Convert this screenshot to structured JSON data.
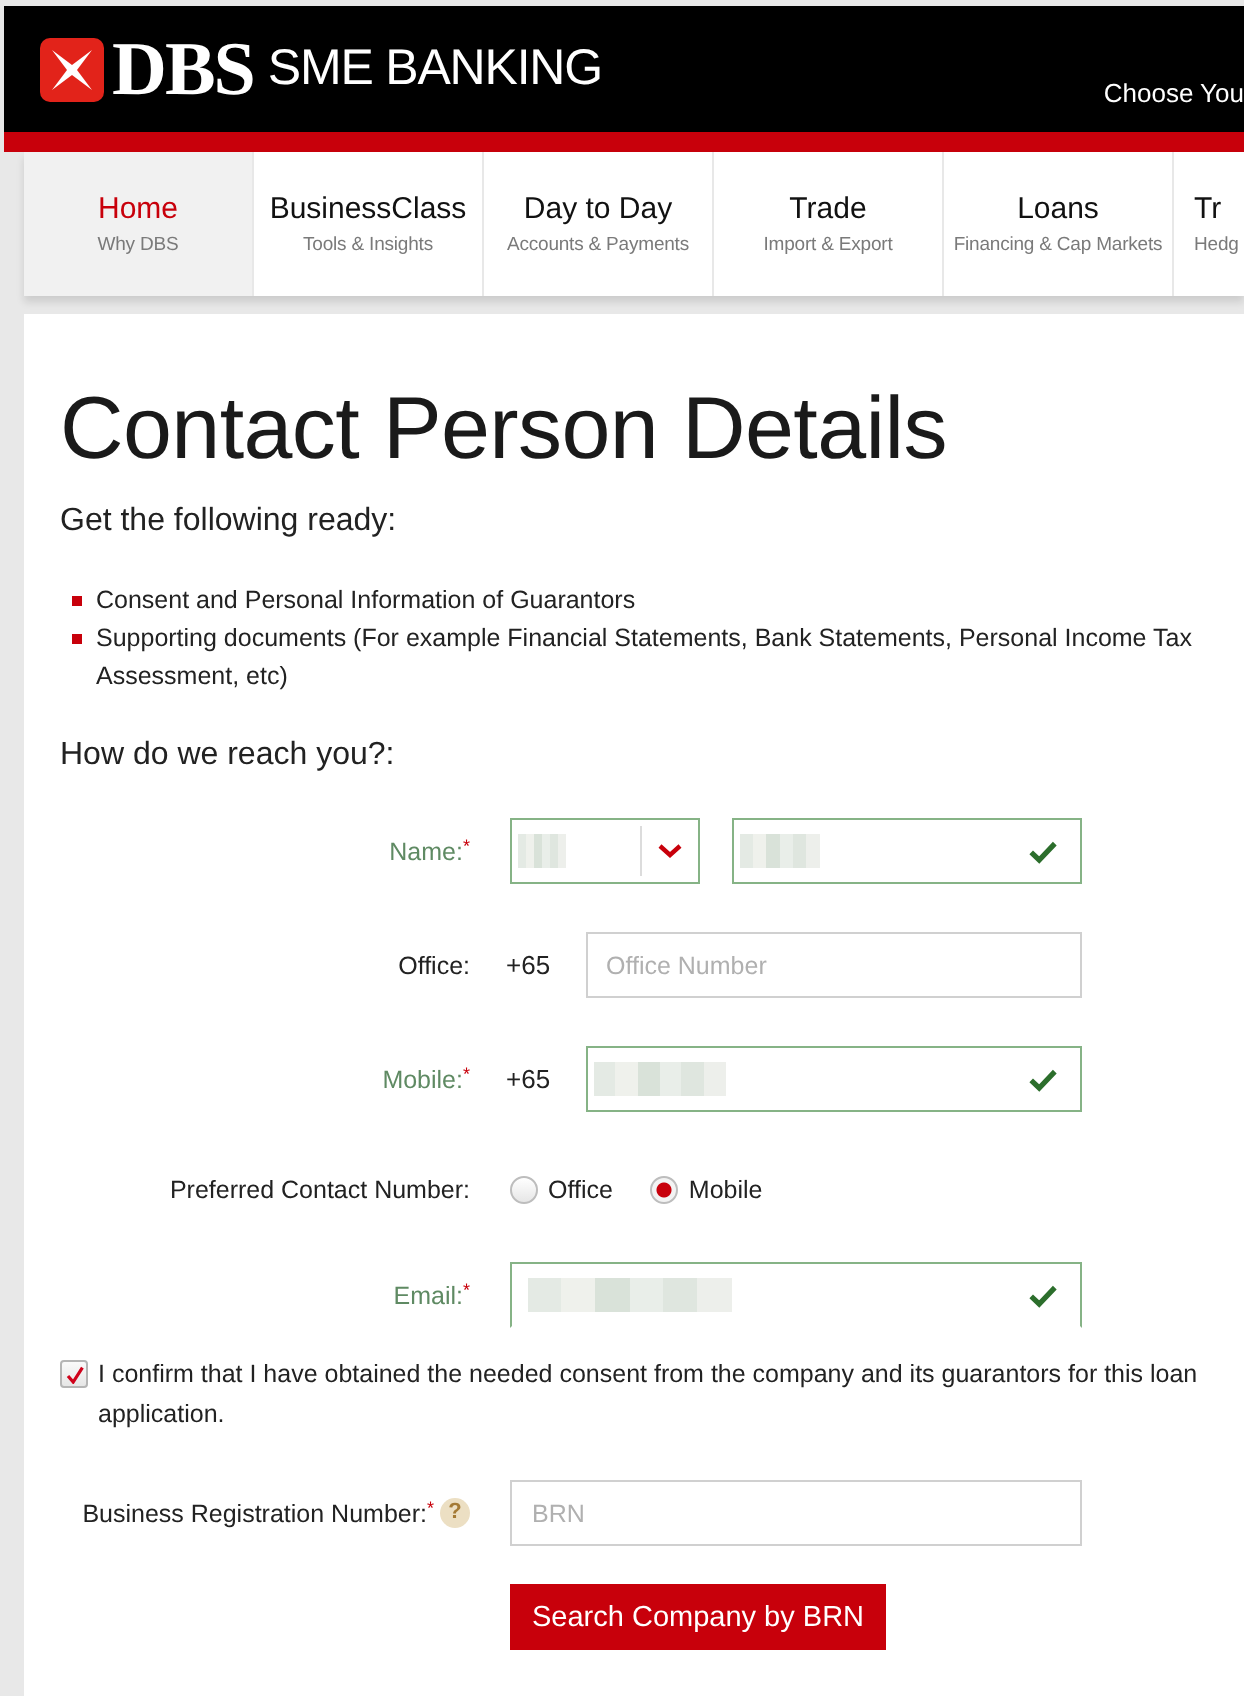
{
  "header": {
    "brand": "DBS",
    "product": "SME BANKING",
    "menu_link": "Choose You"
  },
  "nav": {
    "tabs": [
      {
        "title": "Home",
        "subtitle": "Why DBS",
        "selected": true
      },
      {
        "title": "BusinessClass",
        "subtitle": "Tools & Insights",
        "selected": false
      },
      {
        "title": "Day to Day",
        "subtitle": "Accounts & Payments",
        "selected": false
      },
      {
        "title": "Trade",
        "subtitle": "Import & Export",
        "selected": false
      },
      {
        "title": "Loans",
        "subtitle": "Financing & Cap Markets",
        "selected": false
      },
      {
        "title": "Tr",
        "subtitle": "Hedg",
        "selected": false
      }
    ]
  },
  "page": {
    "title": "Contact Person Details",
    "intro": "Get the following ready:",
    "checklist": [
      "Consent and Personal Information of Guarantors",
      "Supporting documents (For example Financial Statements, Bank Statements, Personal Income Tax Assessment, etc)"
    ]
  },
  "contact_form": {
    "heading": "How do we reach you?:",
    "rows": [
      {
        "kind": "name",
        "label": "Name:$^{*}$",
        "valid": true,
        "fields": [
          {
            "kind": "select",
            "blurred": true
          },
          {
            "kind": "text",
            "blurred": true
          }
        ]
      },
      {
        "kind": "phone",
        "label": "Office:",
        "valid": false,
        "prefix": "+65",
        "fields": [
          {
            "kind": "text",
            "placeholder": "Office Number"
          }
        ]
      },
      {
        "kind": "phone",
        "label": "Mobile:$^{*}$",
        "valid": true,
        "prefix": "+65",
        "fields": [
          {
            "kind": "text",
            "blurred": true
          }
        ]
      },
      {
        "kind": "radio",
        "label": "Preferred Contact Number:",
        "options": [
          {
            "label": "Office",
            "selected": false
          },
          {
            "label": "Mobile",
            "selected": true
          }
        ]
      },
      {
        "kind": "email",
        "label": "Email:$^{*}$",
        "valid": true,
        "fields": [
          {
            "kind": "text",
            "blurred": true
          }
        ]
      }
    ]
  },
  "consent": {
    "checked": true,
    "text": "I confirm that I have obtained the needed consent from the company and its guarantors for this loan application."
  },
  "brn_search": {
    "label": "Business Registration Number:$^{*}$",
    "help_icon": "?",
    "placeholder": "BRN",
    "button": "Search Company by BRN"
  }
}
